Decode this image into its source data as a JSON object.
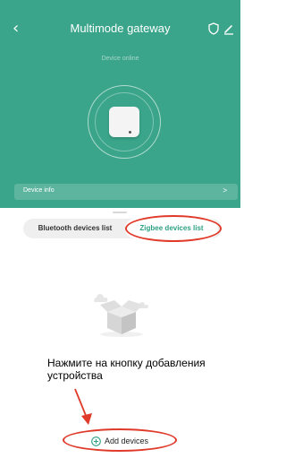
{
  "header": {
    "title": "Multimode gateway",
    "back_icon": "chevron-left-icon",
    "status_text": "Device online"
  },
  "device_info": {
    "label": "Device info",
    "chevron": ">"
  },
  "tabs": [
    {
      "label": "Bluetooth devices list",
      "selected": false
    },
    {
      "label": "Zigbee devices list",
      "selected": true
    }
  ],
  "empty_state_icon": "empty-box-icon",
  "annotation": {
    "text": "Нажмите на кнопку добавления устройства",
    "color": "#e03a2a"
  },
  "add_devices": {
    "label": "Add devices",
    "icon": "plus-circle-icon"
  },
  "colors": {
    "accent": "#3aa58a",
    "tab_active": "#2fa084",
    "highlight": "#e03a2a"
  }
}
